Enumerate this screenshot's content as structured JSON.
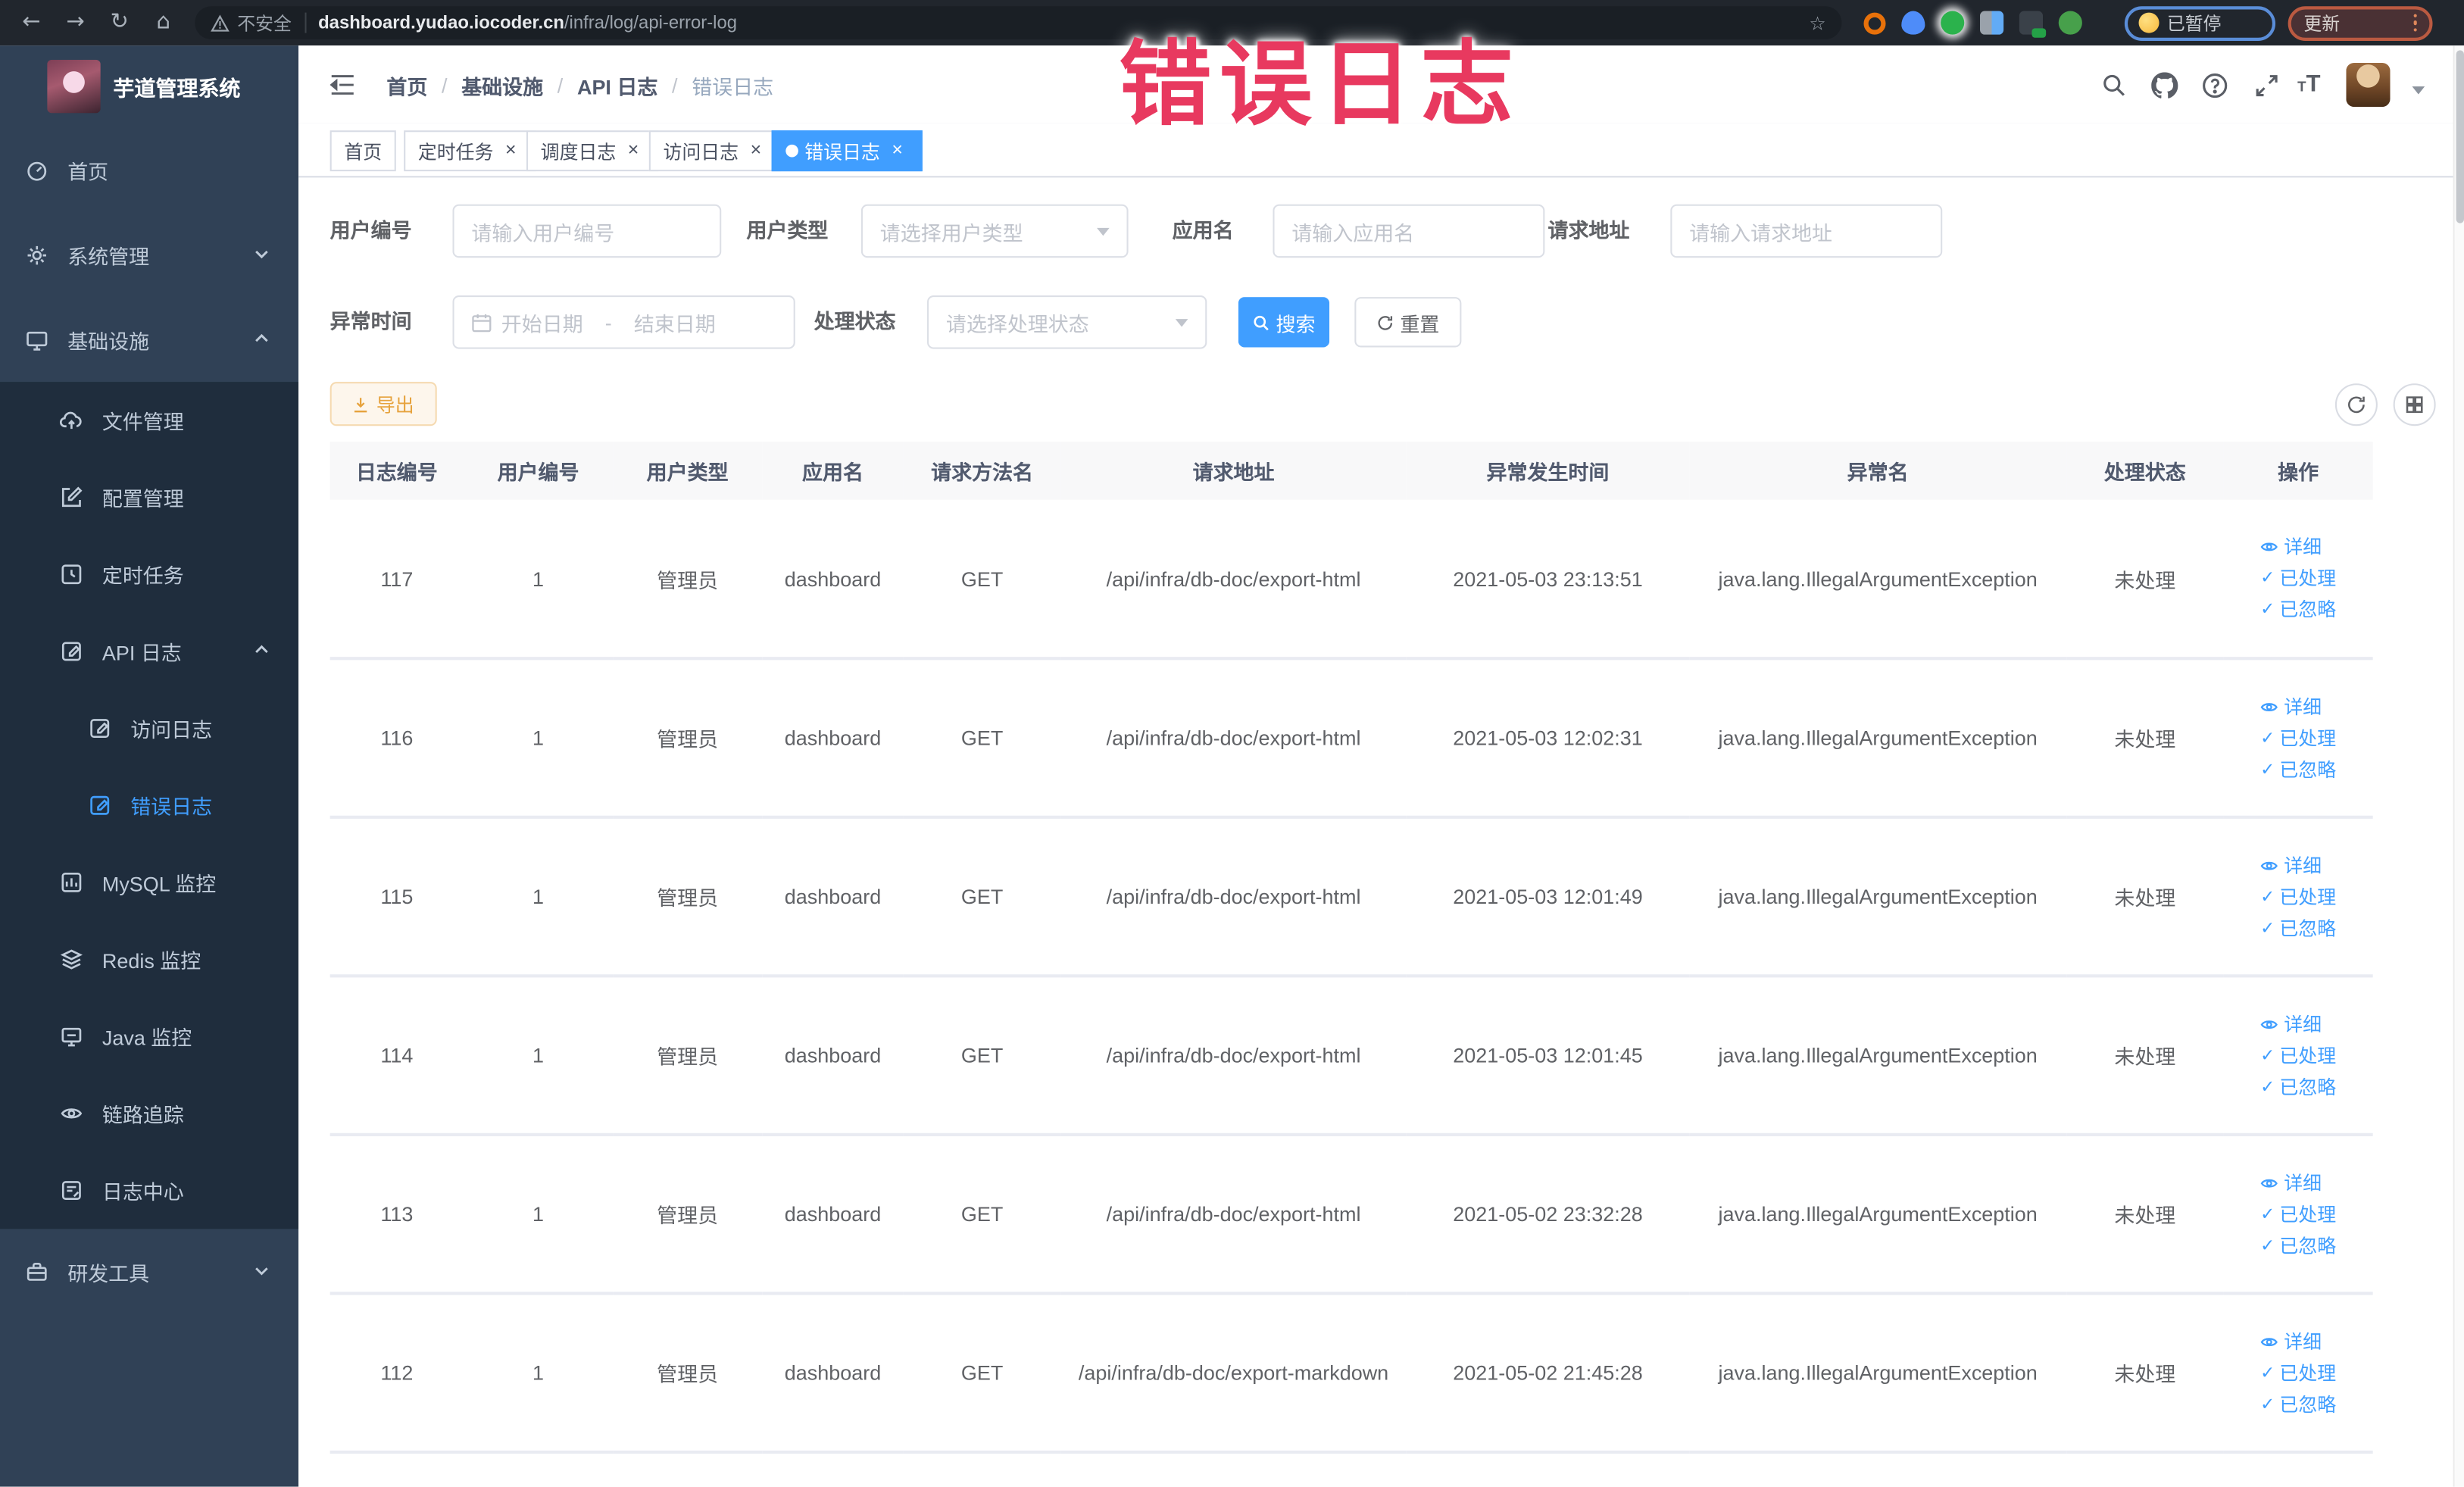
{
  "browser": {
    "security_label": "不安全",
    "url_domain": "dashboard.yudao.iocoder.cn",
    "url_path": "/infra/log/api-error-log",
    "profile_chip_label": "已暂停",
    "update_label": "更新"
  },
  "watermark_text": "错误日志",
  "sidebar": {
    "app_title": "芋道管理系统",
    "items": {
      "home": "首页",
      "system": "系统管理",
      "infra": "基础设施",
      "file": "文件管理",
      "config": "配置管理",
      "job": "定时任务",
      "api_log": "API 日志",
      "access_log": "访问日志",
      "error_log": "错误日志",
      "mysql": "MySQL 监控",
      "redis": "Redis 监控",
      "java": "Java 监控",
      "trace": "链路追踪",
      "log_center": "日志中心",
      "dev_tools": "研发工具"
    }
  },
  "navbar": {
    "breadcrumb": [
      "首页",
      "基础设施",
      "API 日志",
      "错误日志"
    ]
  },
  "tabs": [
    {
      "label": "首页"
    },
    {
      "label": "定时任务"
    },
    {
      "label": "调度日志"
    },
    {
      "label": "访问日志"
    },
    {
      "label": "错误日志"
    }
  ],
  "filters": {
    "user_id": {
      "label": "用户编号",
      "placeholder": "请输入用户编号",
      "value": ""
    },
    "user_type": {
      "label": "用户类型",
      "placeholder": "请选择用户类型",
      "value": ""
    },
    "app_name": {
      "label": "应用名",
      "placeholder": "请输入应用名",
      "value": ""
    },
    "request_url": {
      "label": "请求地址",
      "placeholder": "请输入请求地址",
      "value": ""
    },
    "exception_time": {
      "label": "异常时间",
      "start_placeholder": "开始日期",
      "separator": "-",
      "end_placeholder": "结束日期",
      "value": ""
    },
    "process_status": {
      "label": "处理状态",
      "placeholder": "请选择处理状态",
      "value": ""
    },
    "search_label": "搜索",
    "reset_label": "重置"
  },
  "toolbar": {
    "export_label": "导出"
  },
  "table": {
    "columns": [
      "日志编号",
      "用户编号",
      "用户类型",
      "应用名",
      "请求方法名",
      "请求地址",
      "异常发生时间",
      "异常名",
      "处理状态",
      "操作"
    ],
    "actions": [
      "详细",
      "已处理",
      "已忽略"
    ],
    "rows": [
      {
        "id": "117",
        "user_id": "1",
        "user_type": "管理员",
        "app_name": "dashboard",
        "method": "GET",
        "url": "/api/infra/db-doc/export-html",
        "time": "2021-05-03 23:13:51",
        "exception": "java.lang.IllegalArgumentException",
        "status": "未处理"
      },
      {
        "id": "116",
        "user_id": "1",
        "user_type": "管理员",
        "app_name": "dashboard",
        "method": "GET",
        "url": "/api/infra/db-doc/export-html",
        "time": "2021-05-03 12:02:31",
        "exception": "java.lang.IllegalArgumentException",
        "status": "未处理"
      },
      {
        "id": "115",
        "user_id": "1",
        "user_type": "管理员",
        "app_name": "dashboard",
        "method": "GET",
        "url": "/api/infra/db-doc/export-html",
        "time": "2021-05-03 12:01:49",
        "exception": "java.lang.IllegalArgumentException",
        "status": "未处理"
      },
      {
        "id": "114",
        "user_id": "1",
        "user_type": "管理员",
        "app_name": "dashboard",
        "method": "GET",
        "url": "/api/infra/db-doc/export-html",
        "time": "2021-05-03 12:01:45",
        "exception": "java.lang.IllegalArgumentException",
        "status": "未处理"
      },
      {
        "id": "113",
        "user_id": "1",
        "user_type": "管理员",
        "app_name": "dashboard",
        "method": "GET",
        "url": "/api/infra/db-doc/export-html",
        "time": "2021-05-02 23:32:28",
        "exception": "java.lang.IllegalArgumentException",
        "status": "未处理"
      },
      {
        "id": "112",
        "user_id": "1",
        "user_type": "管理员",
        "app_name": "dashboard",
        "method": "GET",
        "url": "/api/infra/db-doc/export-markdown",
        "time": "2021-05-02 21:45:28",
        "exception": "java.lang.IllegalArgumentException",
        "status": "未处理"
      }
    ]
  },
  "colors": {
    "accent": "#409eff",
    "watermark": "#e8395f",
    "warning": "#e6a23c",
    "sidebar_bg": "#304156",
    "sidebar_sub_bg": "#1f2d3d"
  }
}
